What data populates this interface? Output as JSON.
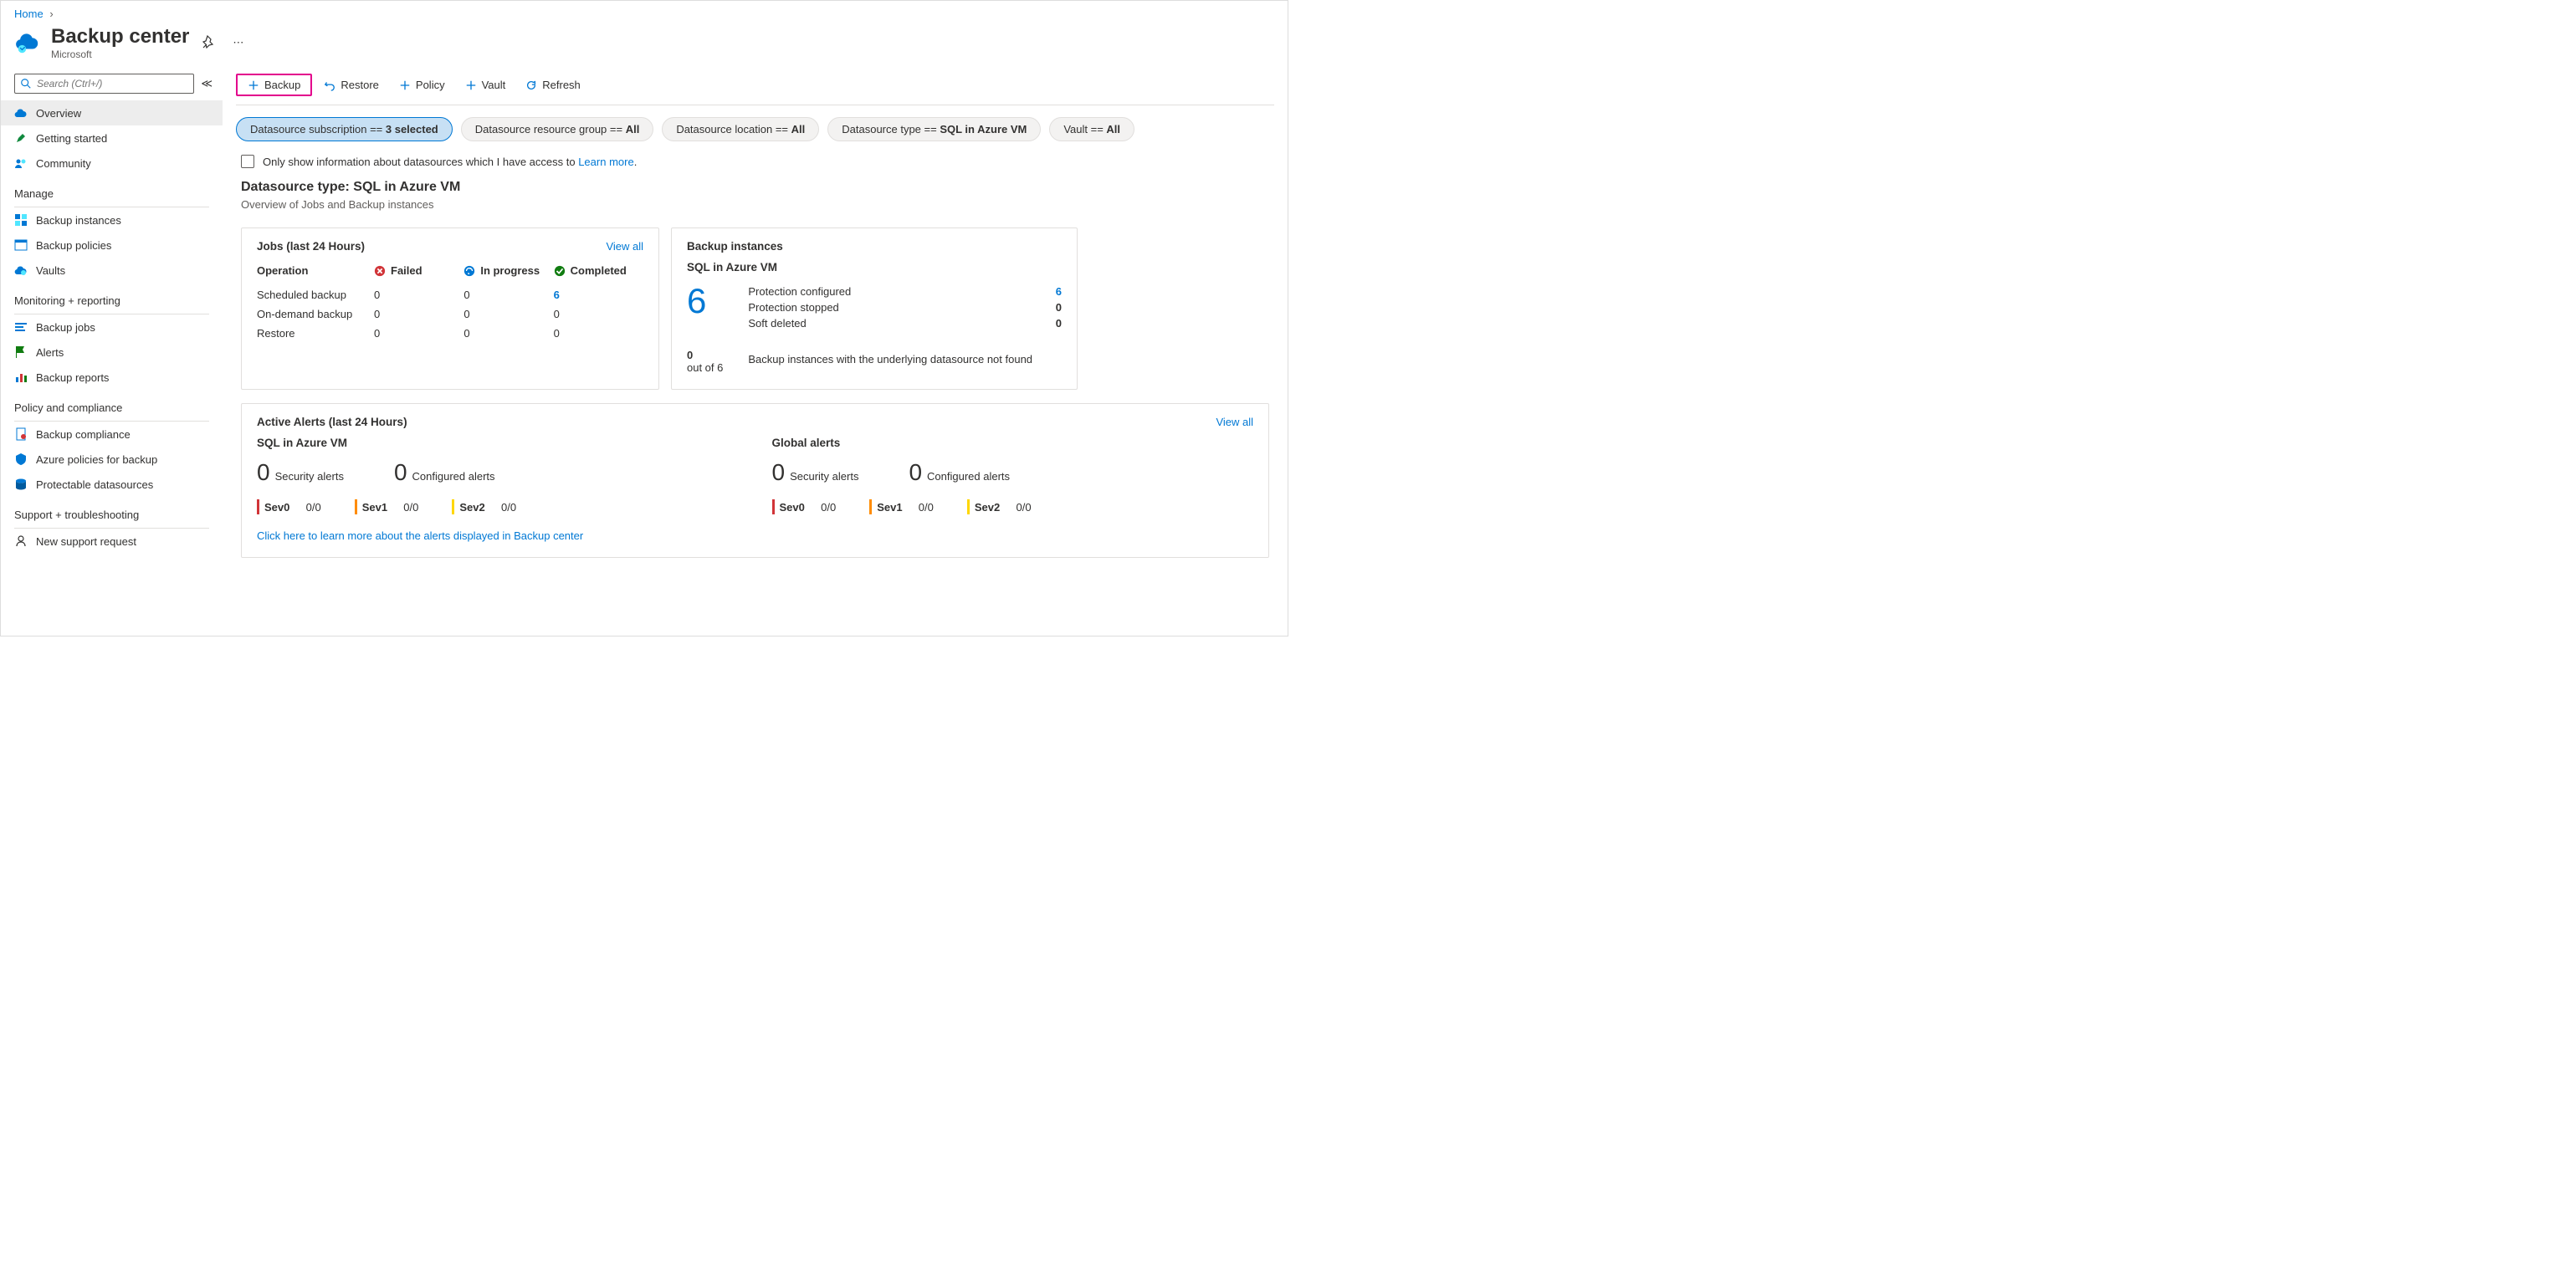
{
  "breadcrumb": {
    "home": "Home"
  },
  "header": {
    "title": "Backup center",
    "subtitle": "Microsoft"
  },
  "search": {
    "placeholder": "Search (Ctrl+/)"
  },
  "nav": {
    "overview": "Overview",
    "getting_started": "Getting started",
    "community": "Community",
    "section_manage": "Manage",
    "backup_instances": "Backup instances",
    "backup_policies": "Backup policies",
    "vaults": "Vaults",
    "section_monitoring": "Monitoring + reporting",
    "backup_jobs": "Backup jobs",
    "alerts": "Alerts",
    "backup_reports": "Backup reports",
    "section_policy": "Policy and compliance",
    "backup_compliance": "Backup compliance",
    "azure_policies": "Azure policies for backup",
    "protectable": "Protectable datasources",
    "section_support": "Support + troubleshooting",
    "new_request": "New support request"
  },
  "toolbar": {
    "backup": "Backup",
    "restore": "Restore",
    "policy": "Policy",
    "vault": "Vault",
    "refresh": "Refresh"
  },
  "pills": {
    "sub_label": "Datasource subscription == ",
    "sub_value": "3 selected",
    "rg_label": "Datasource resource group == ",
    "rg_value": "All",
    "loc_label": "Datasource location == ",
    "loc_value": "All",
    "type_label": "Datasource type == ",
    "type_value": "SQL in Azure VM",
    "vault_label": "Vault == ",
    "vault_value": "All"
  },
  "info": {
    "text": "Only show information about datasources which I have access to ",
    "link": "Learn more"
  },
  "type_header": {
    "title": "Datasource type: SQL in Azure VM",
    "sub": "Overview of Jobs and Backup instances"
  },
  "jobs": {
    "title": "Jobs (last 24 Hours)",
    "view_all": "View all",
    "op_header": "Operation",
    "failed": "Failed",
    "in_progress": "In progress",
    "completed": "Completed",
    "rows": {
      "scheduled": {
        "label": "Scheduled backup",
        "failed": "0",
        "in_progress": "0",
        "completed": "6"
      },
      "ondemand": {
        "label": "On-demand backup",
        "failed": "0",
        "in_progress": "0",
        "completed": "0"
      },
      "restore": {
        "label": "Restore",
        "failed": "0",
        "in_progress": "0",
        "completed": "0"
      }
    }
  },
  "instances": {
    "title": "Backup instances",
    "subtitle": "SQL in Azure VM",
    "big": "6",
    "out_n": "0",
    "out_label": "out of 6",
    "rows": {
      "configured": {
        "label": "Protection configured",
        "value": "6"
      },
      "stopped": {
        "label": "Protection stopped",
        "value": "0"
      },
      "deleted": {
        "label": "Soft deleted",
        "value": "0"
      }
    },
    "note": "Backup instances with the underlying datasource not found"
  },
  "alerts": {
    "title": "Active Alerts (last 24 Hours)",
    "view_all": "View all",
    "local_title": "SQL in Azure VM",
    "global_title": "Global alerts",
    "security": {
      "n": "0",
      "label": "Security alerts"
    },
    "configured": {
      "n": "0",
      "label": "Configured alerts"
    },
    "sev0": {
      "label": "Sev0",
      "val": "0/0"
    },
    "sev1": {
      "label": "Sev1",
      "val": "0/0"
    },
    "sev2": {
      "label": "Sev2",
      "val": "0/0"
    },
    "link": "Click here to learn more about the alerts displayed in Backup center"
  }
}
